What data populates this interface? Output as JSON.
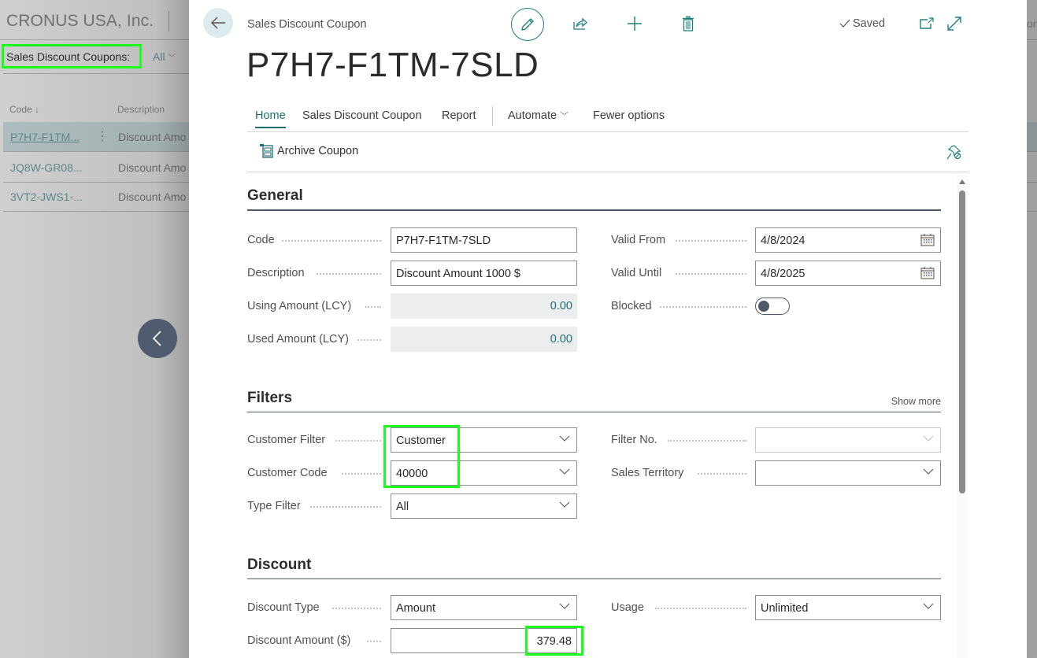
{
  "background": {
    "company": "CRONUS USA, Inc.",
    "list_title": "Sales Discount Coupons:",
    "filter_view": "All",
    "columns": [
      "Code",
      "Description"
    ],
    "rows": [
      {
        "code": "P7H7-F1TM...",
        "description": "Discount Amo",
        "selected": true
      },
      {
        "code": "JQ8W-GR08...",
        "description": "Discount Amo",
        "selected": false
      },
      {
        "code": "3VT2-JWS1-...",
        "description": "Discount Amo",
        "selected": false
      }
    ],
    "right_fragment": "or"
  },
  "card": {
    "caption": "Sales Discount Coupon",
    "title": "P7H7-F1TM-7SLD",
    "saved_label": "Saved",
    "tabs": [
      {
        "label": "Home",
        "active": true
      },
      {
        "label": "Sales Discount Coupon",
        "active": false
      },
      {
        "label": "Report",
        "active": false
      },
      {
        "label": "Automate",
        "active": false
      },
      {
        "label": "Fewer options",
        "active": false
      }
    ],
    "actions": {
      "archive_label": "Archive Coupon"
    },
    "general": {
      "title": "General",
      "code_label": "Code",
      "code_value": "P7H7-F1TM-7SLD",
      "description_label": "Description",
      "description_value": "Discount Amount 1000 $",
      "using_amount_label": "Using Amount (LCY)",
      "using_amount_value": "0.00",
      "used_amount_label": "Used Amount (LCY)",
      "used_amount_value": "0.00",
      "valid_from_label": "Valid From",
      "valid_from_value": "4/8/2024",
      "valid_until_label": "Valid Until",
      "valid_until_value": "4/8/2025",
      "blocked_label": "Blocked",
      "blocked_value": false
    },
    "filters": {
      "title": "Filters",
      "show_more": "Show more",
      "customer_filter_label": "Customer Filter",
      "customer_filter_value": "Customer",
      "customer_code_label": "Customer Code",
      "customer_code_value": "40000",
      "type_filter_label": "Type Filter",
      "type_filter_value": "All",
      "filter_no_label": "Filter No.",
      "filter_no_value": "",
      "sales_territory_label": "Sales Territory",
      "sales_territory_value": ""
    },
    "discount": {
      "title": "Discount",
      "discount_type_label": "Discount Type",
      "discount_type_value": "Amount",
      "discount_amount_label": "Discount Amount ($)",
      "discount_amount_value": "379.48",
      "usage_label": "Usage",
      "usage_value": "Unlimited"
    }
  },
  "colors": {
    "accent": "#1e6f74",
    "highlight": "#1aff1a",
    "nav_button": "#4f5b6e"
  }
}
